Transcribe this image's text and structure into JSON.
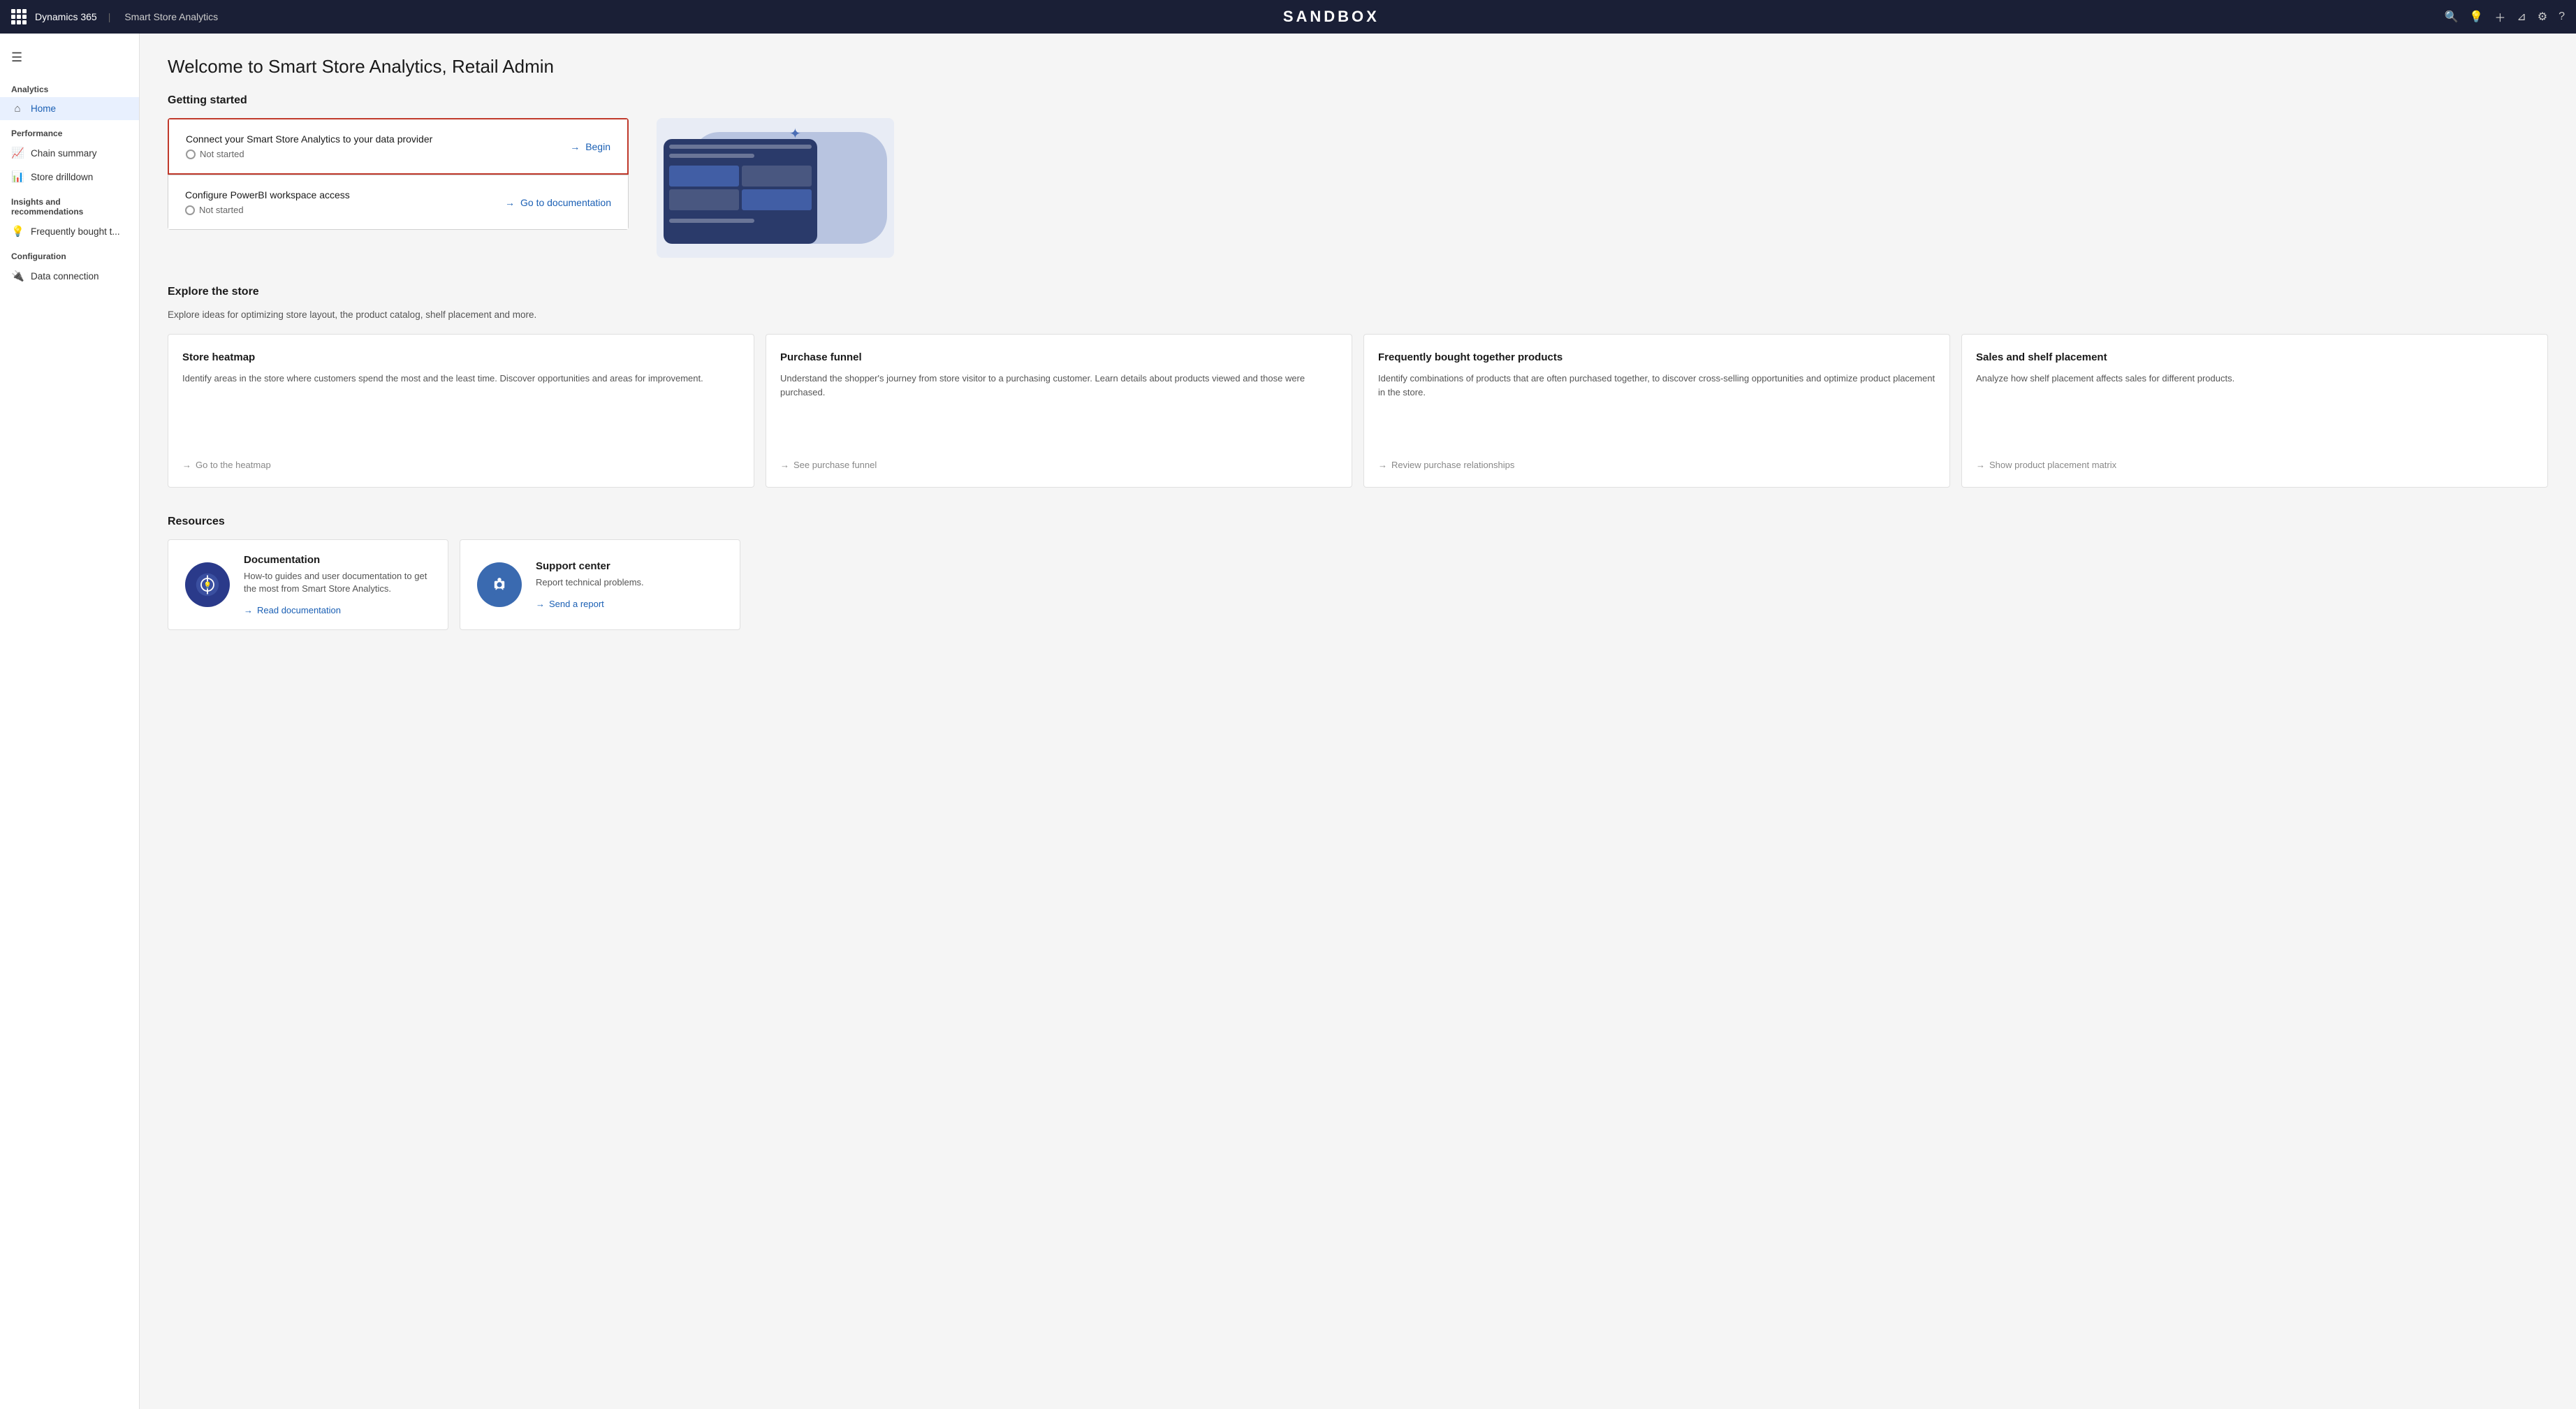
{
  "topbar": {
    "grid_label": "Dynamics 365",
    "module_label": "Smart Store Analytics",
    "sandbox_label": "SANDBOX",
    "icons": [
      "search-icon",
      "lightbulb-icon",
      "plus-icon",
      "filter-icon",
      "settings-icon",
      "help-icon"
    ]
  },
  "sidebar": {
    "hamburger_label": "☰",
    "sections": [
      {
        "label": "Analytics",
        "items": [
          {
            "id": "home",
            "icon": "🏠",
            "label": "Home",
            "active": true
          }
        ]
      },
      {
        "label": "Performance",
        "items": [
          {
            "id": "chain-summary",
            "icon": "📈",
            "label": "Chain summary",
            "active": false
          },
          {
            "id": "store-drilldown",
            "icon": "📊",
            "label": "Store drilldown",
            "active": false
          }
        ]
      },
      {
        "label": "Insights and recommendations",
        "items": [
          {
            "id": "frequently-bought",
            "icon": "💡",
            "label": "Frequently bought t...",
            "active": false
          }
        ]
      },
      {
        "label": "Configuration",
        "items": [
          {
            "id": "data-connection",
            "icon": "🔌",
            "label": "Data connection",
            "active": false
          }
        ]
      }
    ]
  },
  "main": {
    "page_title": "Welcome to Smart Store Analytics, Retail Admin",
    "getting_started": {
      "section_title": "Getting started",
      "cards": [
        {
          "title": "Connect your Smart Store Analytics to your data provider",
          "status": "Not started",
          "action_label": "Begin",
          "highlighted": true
        },
        {
          "title": "Configure PowerBI workspace access",
          "status": "Not started",
          "action_label": "Go to documentation",
          "highlighted": false
        }
      ]
    },
    "explore": {
      "section_title": "Explore the store",
      "description": "Explore ideas for optimizing store layout, the product catalog, shelf placement and more.",
      "cards": [
        {
          "title": "Store heatmap",
          "description": "Identify areas in the store where customers spend the most and the least time. Discover opportunities and areas for improvement.",
          "link": "Go to the heatmap"
        },
        {
          "title": "Purchase funnel",
          "description": "Understand the shopper's journey from store visitor to a purchasing customer. Learn details about products viewed and those were purchased.",
          "link": "See purchase funnel"
        },
        {
          "title": "Frequently bought together products",
          "description": "Identify combinations of products that are often purchased together, to discover cross-selling opportunities and optimize product placement in the store.",
          "link": "Review purchase relationships"
        },
        {
          "title": "Sales and shelf placement",
          "description": "Analyze how shelf placement affects sales for different products.",
          "link": "Show product placement matrix"
        }
      ]
    },
    "resources": {
      "section_title": "Resources",
      "cards": [
        {
          "title": "Documentation",
          "description": "How-to guides and user documentation to get the most from Smart Store Analytics.",
          "link": "Read documentation",
          "icon_type": "docs"
        },
        {
          "title": "Support center",
          "description": "Report technical problems.",
          "link": "Send a report",
          "icon_type": "support"
        }
      ]
    }
  }
}
